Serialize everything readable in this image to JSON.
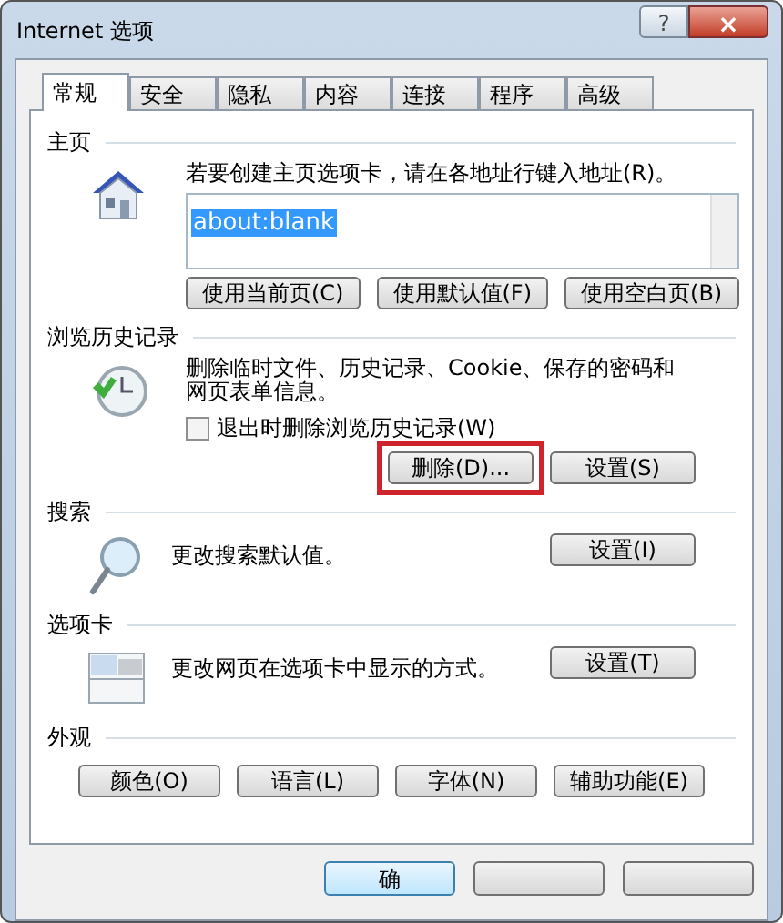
{
  "window": {
    "title": "Internet 选项",
    "help": "?",
    "close": "×"
  },
  "tabs": [
    {
      "label": "常规",
      "selected": true
    },
    {
      "label": "安全",
      "selected": false
    },
    {
      "label": "隐私",
      "selected": false
    },
    {
      "label": "内容",
      "selected": false
    },
    {
      "label": "连接",
      "selected": false
    },
    {
      "label": "程序",
      "selected": false
    },
    {
      "label": "高级",
      "selected": false
    }
  ],
  "groups": [
    {
      "kind": "home",
      "title": "主页",
      "description": "若要创建主页选项卡，请在各地址行键入地址(R)。",
      "field_value": "about:blank",
      "buttons": [
        {
          "label": "使用当前页(C)",
          "highlighted": false
        },
        {
          "label": "使用默认值(F)",
          "highlighted": false
        },
        {
          "label": "使用空白页(B)",
          "highlighted": false
        }
      ]
    },
    {
      "kind": "history",
      "title": "浏览历史记录",
      "description": "删除临时文件、历史记录、Cookie、保存的密码和网页表单信息。",
      "checkbox": {
        "label": "退出时删除浏览历史记录(W)",
        "checked": false
      },
      "buttons": [
        {
          "label": "删除(D)...",
          "highlighted": true
        },
        {
          "label": "设置(S)",
          "highlighted": false
        }
      ]
    },
    {
      "kind": "search",
      "title": "搜索",
      "description": "更改搜索默认值。",
      "buttons": [
        {
          "label": "设置(I)",
          "highlighted": false
        }
      ]
    },
    {
      "kind": "tabs",
      "title": "选项卡",
      "description": "更改网页在选项卡中显示的方式。",
      "buttons": [
        {
          "label": "设置(T)",
          "highlighted": false
        }
      ]
    },
    {
      "kind": "appearance",
      "title": "外观",
      "buttons": [
        {
          "label": "颜色(O)",
          "highlighted": false
        },
        {
          "label": "语言(L)",
          "highlighted": false
        },
        {
          "label": "字体(N)",
          "highlighted": false
        },
        {
          "label": "辅助功能(E)",
          "highlighted": false
        }
      ]
    }
  ],
  "dialog_buttons": [
    {
      "label": "确",
      "default": true
    },
    {
      "default": false
    },
    {
      "default": false
    }
  ]
}
